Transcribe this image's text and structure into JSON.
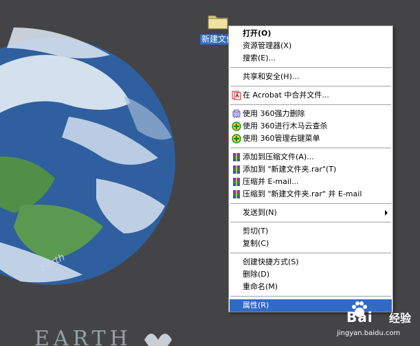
{
  "desktop": {
    "folder_label": "新建文件"
  },
  "context_menu": {
    "items": [
      {
        "label": "打开(O)",
        "icon": "none"
      },
      {
        "label": "资源管理器(X)",
        "icon": "none"
      },
      {
        "label": "搜索(E)...",
        "icon": "none"
      },
      {
        "label": "共享和安全(H)...",
        "icon": "none"
      },
      {
        "label": "在 Acrobat 中合并文件...",
        "icon": "acrobat-icon"
      },
      {
        "label": "使用 360强力删除",
        "icon": "360-shred-icon"
      },
      {
        "label": "使用 360进行木马云查杀",
        "icon": "360-scan-icon"
      },
      {
        "label": "使用 360管理右键菜单",
        "icon": "360-manage-icon"
      },
      {
        "label": "添加到压缩文件(A)...",
        "icon": "winrar-icon"
      },
      {
        "label": "添加到 \"新建文件夹.rar\"(T)",
        "icon": "winrar-icon"
      },
      {
        "label": "压缩并 E-mail...",
        "icon": "winrar-icon"
      },
      {
        "label": "压缩到 \"新建文件夹.rar\" 并 E-mail",
        "icon": "winrar-icon"
      },
      {
        "label": "发送到(N)",
        "icon": "none"
      },
      {
        "label": "剪切(T)",
        "icon": "none"
      },
      {
        "label": "复制(C)",
        "icon": "none"
      },
      {
        "label": "创建快捷方式(S)",
        "icon": "none"
      },
      {
        "label": "删除(D)",
        "icon": "none"
      },
      {
        "label": "重命名(M)",
        "icon": "none"
      },
      {
        "label": "属性(R)",
        "icon": "none"
      }
    ]
  },
  "wallpaper": {
    "planet_text": "Earth"
  },
  "watermark": {
    "brand_text": "Bai",
    "brand_text2": "经验",
    "url_text": "jingyan.baidu.com"
  },
  "colors": {
    "desktop_bg": "#444446",
    "highlight": "#316ac5",
    "ocean": "#2f5f9e",
    "land": "#4f8f48"
  }
}
